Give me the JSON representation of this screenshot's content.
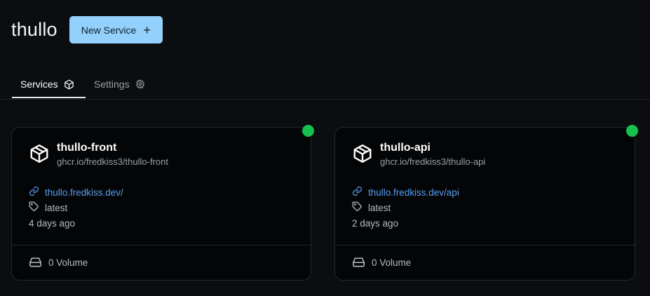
{
  "header": {
    "title": "thullo",
    "new_service_label": "New Service"
  },
  "tabs": [
    {
      "label": "Services",
      "icon": "cube-icon",
      "active": true
    },
    {
      "label": "Settings",
      "icon": "gear-icon",
      "active": false
    }
  ],
  "services": [
    {
      "name": "thullo-front",
      "image": "ghcr.io/fredkiss3/thullo-front",
      "url": "thullo.fredkiss.dev/",
      "tag": "latest",
      "updated": "4 days ago",
      "volumes": "0 Volume",
      "status_color": "#16c24b"
    },
    {
      "name": "thullo-api",
      "image": "ghcr.io/fredkiss3/thullo-api",
      "url": "thullo.fredkiss.dev/api",
      "tag": "latest",
      "updated": "2 days ago",
      "volumes": "0 Volume",
      "status_color": "#16c24b"
    }
  ],
  "colors": {
    "accent_button": "#93d0fb",
    "link": "#5a9ef0",
    "status_ok": "#16c24b",
    "background": "#0b0d10"
  }
}
